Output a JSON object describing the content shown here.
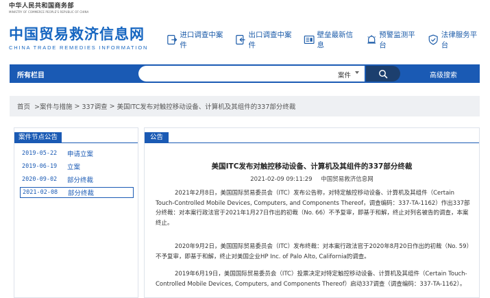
{
  "header": {
    "ministry_cn": "中华人民共和国商务部",
    "ministry_en": "MINISTRY OF COMMERCE PEOPLE'S REPUBLIC OF CHINA",
    "site_cn": "中国贸易救济信息网",
    "site_en": "CHINA TRADE REMEDIES INFORMATION"
  },
  "quicklinks": [
    {
      "label": "进口调查中案件",
      "icon": "import-case-icon"
    },
    {
      "label": "出口调查中案件",
      "icon": "export-case-icon"
    },
    {
      "label": "壁垒最新信息",
      "icon": "barrier-info-icon"
    },
    {
      "label": "预警监测平台",
      "icon": "warning-monitor-icon"
    },
    {
      "label": "法律服务平台",
      "icon": "legal-shield-icon"
    }
  ],
  "navbar": {
    "all_columns": "所有栏目",
    "search_type": "案件",
    "search_placeholder": "",
    "advanced_search": "高级搜索"
  },
  "breadcrumb": {
    "items": [
      "首页",
      ">案件与措施",
      ">",
      "337调查",
      ">",
      "美国ITC发布对触控移动设备、计算机及其组件的337部分终裁"
    ]
  },
  "sidebar": {
    "title": "案件节点公告",
    "items": [
      {
        "date": "2019-05-22",
        "label": "申请立案"
      },
      {
        "date": "2019-06-19",
        "label": "立案"
      },
      {
        "date": "2020-09-02",
        "label": "部分终裁"
      },
      {
        "date": "2021-02-08",
        "label": "部分终裁"
      }
    ]
  },
  "article": {
    "section": "公告",
    "title": "美国ITC发布对触控移动设备、计算机及其组件的337部分终裁",
    "date": "2021-02-09 09:11:29",
    "source": "中国贸易救济信息网",
    "paragraphs": [
      "2021年2月8日，美国国际贸易委员会（ITC）发布公告称，对特定触控移动设备、计算机及其组件（Certain Touch-Controlled Mobile Devices, Computers, and Components Thereof，调查编码：337-TA-1162）作出337部分终裁：对本案行政法官于2021年1月27日作出的初裁（No. 66）不予复审，即基于和解，终止对列名被告的调查，本案终止。",
      "2020年9月2日，美国国际贸易委员会（ITC）发布终裁：对本案行政法官于2020年8月20日作出的初裁（No. 59）不予复审，即基于和解，终止对美国企业HP Inc. of Palo Alto, California的调查。",
      "2019年6月19日，美国国际贸易委员会（ITC）投票决定对特定触控移动设备、计算机及其组件（Certain Touch-Controlled Mobile Devices, Computers, and Components Thereof）启动337调查（调查编码：337-TA-1162）。"
    ]
  },
  "colors": {
    "primary": "#1a5ab4",
    "brand": "#1565c0",
    "search_button": "#1c3f6e",
    "breadcrumb_bg": "#eef0f3"
  }
}
